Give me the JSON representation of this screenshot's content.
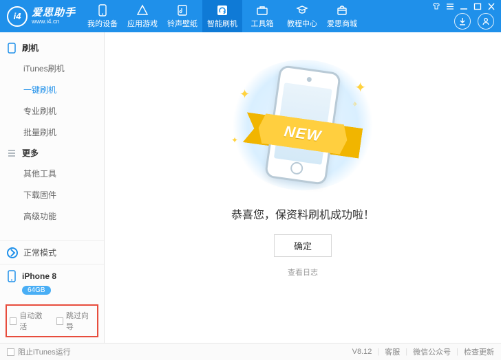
{
  "brand": {
    "logo_text": "i4",
    "name": "爱思助手",
    "url": "www.i4.cn"
  },
  "nav": [
    {
      "key": "device",
      "label": "我的设备"
    },
    {
      "key": "apps",
      "label": "应用游戏"
    },
    {
      "key": "ring",
      "label": "铃声壁纸"
    },
    {
      "key": "flash",
      "label": "智能刷机",
      "active": true
    },
    {
      "key": "tools",
      "label": "工具箱"
    },
    {
      "key": "tutorial",
      "label": "教程中心"
    },
    {
      "key": "mall",
      "label": "爱思商城"
    }
  ],
  "sidebar": {
    "groups": [
      {
        "title": "刷机",
        "icon": "phone",
        "items": [
          {
            "label": "iTunes刷机"
          },
          {
            "label": "一键刷机",
            "active": true
          },
          {
            "label": "专业刷机"
          },
          {
            "label": "批量刷机"
          }
        ]
      },
      {
        "title": "更多",
        "icon": "list",
        "items": [
          {
            "label": "其他工具"
          },
          {
            "label": "下载固件"
          },
          {
            "label": "高级功能"
          }
        ]
      }
    ],
    "mode_label": "正常模式",
    "device": {
      "name": "iPhone 8",
      "capacity": "64GB"
    },
    "checkboxes": {
      "auto_activate": "自动激活",
      "skip_guide": "跳过向导"
    }
  },
  "main": {
    "ribbon": "NEW",
    "message": "恭喜您，保资料刷机成功啦！",
    "ok": "确定",
    "view_log": "查看日志"
  },
  "status": {
    "block_itunes": "阻止iTunes运行",
    "version": "V8.12",
    "support": "客服",
    "wechat": "微信公众号",
    "update": "检查更新"
  }
}
